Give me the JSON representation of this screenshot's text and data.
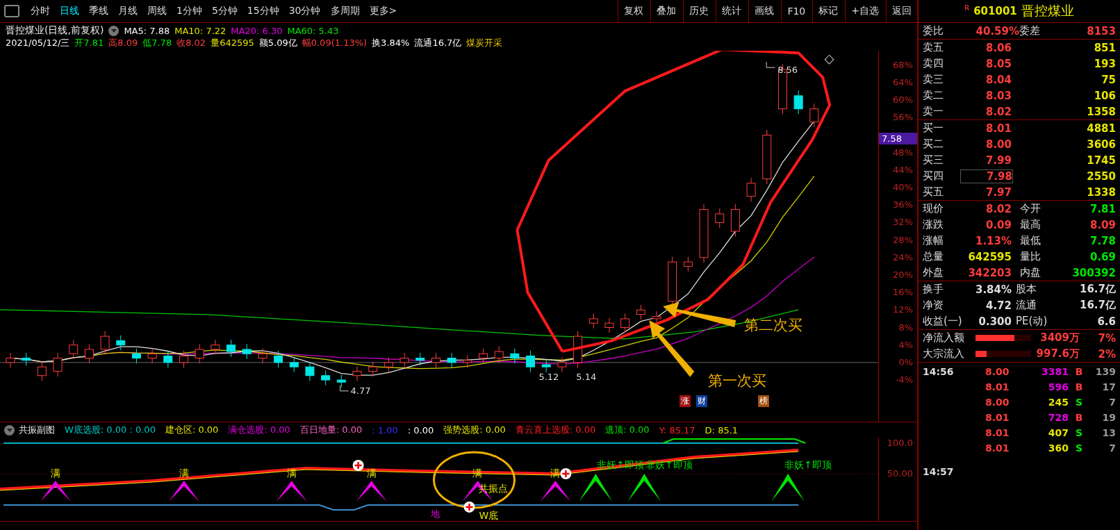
{
  "toolbar": {
    "tabs": [
      {
        "label": "分时",
        "selected": false
      },
      {
        "label": "日线",
        "selected": true
      },
      {
        "label": "季线",
        "selected": false
      },
      {
        "label": "月线",
        "selected": false
      },
      {
        "label": "周线",
        "selected": false
      },
      {
        "label": "1分钟",
        "selected": false
      },
      {
        "label": "5分钟",
        "selected": false
      },
      {
        "label": "15分钟",
        "selected": false
      },
      {
        "label": "30分钟",
        "selected": false
      },
      {
        "label": "多周期",
        "selected": false
      },
      {
        "label": "更多>",
        "selected": false
      }
    ],
    "buttons": [
      "复权",
      "叠加",
      "历史",
      "统计",
      "画线",
      "F10",
      "标记",
      "+自选",
      "返回"
    ]
  },
  "chart_header": {
    "title": "晋控煤业(日线,前复权)",
    "averages": [
      {
        "label": "MA5: 7.88",
        "color": "#ffffff"
      },
      {
        "label": "MA10: 7.22",
        "color": "#e6e600"
      },
      {
        "label": "MA20: 6.30",
        "color": "#e600e6"
      },
      {
        "label": "MA60: 5.43",
        "color": "#00e600"
      }
    ],
    "quote": [
      {
        "text": "2021/05/12/三",
        "color": "#ffffff"
      },
      {
        "text": "开7.81",
        "color": "#00e600"
      },
      {
        "text": "高8.09",
        "color": "#ff3c3c"
      },
      {
        "text": "低7.78",
        "color": "#00e600"
      },
      {
        "text": "收8.02",
        "color": "#ff3c3c"
      },
      {
        "text": "量642595",
        "color": "#e6e600"
      },
      {
        "text": "额5.09亿",
        "color": "#ffffff"
      },
      {
        "text": "幅0.09(1.13%)",
        "color": "#ff3c3c"
      },
      {
        "text": "换3.84%",
        "color": "#ffffff"
      },
      {
        "text": "流通16.7亿",
        "color": "#ffffff"
      },
      {
        "text": "煤炭开采",
        "color": "#e6c800"
      }
    ]
  },
  "price_axis": [
    "68%",
    "64%",
    "60%",
    "56%",
    "48%",
    "44%",
    "40%",
    "36%",
    "32%",
    "28%",
    "24%",
    "20%",
    "16%",
    "12%",
    "8%",
    "4%",
    "0%",
    "-4%"
  ],
  "price_tag": "7.58",
  "chart_labels": {
    "high": "8.56",
    "low": "4.77",
    "left_mark": "5.12",
    "right_mark": "5.14"
  },
  "event_marks": [
    "涨",
    "财",
    "榜"
  ],
  "callouts": [
    "第二次买",
    "第一次买"
  ],
  "indicator": {
    "title": "共振副图",
    "values": [
      {
        "text": "W底选股: 0.00 : 0.00",
        "color": "#00c8c8"
      },
      {
        "text": "建仓区: 0.00",
        "color": "#e6e600"
      },
      {
        "text": "满仓选股: 0.00",
        "color": "#e600e6"
      },
      {
        "text": "百日地量: 0.00",
        "color": "#ff64c8"
      },
      {
        "text": ": 1.00",
        "color": "#3232ff"
      },
      {
        "text": ": 0.00",
        "color": "#ffffff"
      },
      {
        "text": "强势选股: 0.00",
        "color": "#e6e600"
      },
      {
        "text": "青云直上选股: 0.00",
        "color": "#ff2020"
      },
      {
        "text": "逃顶: 0.00",
        "color": "#00e600"
      },
      {
        "text": "Y: 85.17",
        "color": "#ff2020"
      },
      {
        "text": "D: 85.1",
        "color": "#e6e600"
      }
    ],
    "axis": [
      "100.0",
      "50.00"
    ],
    "full_marks": [
      "满",
      "满",
      "满",
      "满",
      "满",
      "满"
    ],
    "top_marks": [
      "非妖↑即顶",
      "非妖↑即顶",
      "非妖↑即顶"
    ],
    "resonance": "共振点",
    "w_bottom": "W底",
    "ground": "地"
  },
  "quote_panel": {
    "flag": "R",
    "code": "601001",
    "name": "晋控煤业",
    "ratio": {
      "label": "委比",
      "value": "40.59%",
      "diff_label": "委差",
      "diff": "8153"
    },
    "asks": [
      {
        "label": "卖五",
        "price": "8.06",
        "volume": "851"
      },
      {
        "label": "卖四",
        "price": "8.05",
        "volume": "193"
      },
      {
        "label": "卖三",
        "price": "8.04",
        "volume": "75"
      },
      {
        "label": "卖二",
        "price": "8.03",
        "volume": "106"
      },
      {
        "label": "卖一",
        "price": "8.02",
        "volume": "1358"
      }
    ],
    "bids": [
      {
        "label": "买一",
        "price": "8.01",
        "volume": "4881",
        "selected": false
      },
      {
        "label": "买二",
        "price": "8.00",
        "volume": "3606",
        "selected": false
      },
      {
        "label": "买三",
        "price": "7.99",
        "volume": "1745",
        "selected": false
      },
      {
        "label": "买四",
        "price": "7.98",
        "volume": "2550",
        "selected": true
      },
      {
        "label": "买五",
        "price": "7.97",
        "volume": "1338",
        "selected": false
      }
    ],
    "stats": [
      {
        "label": "现价",
        "value": "8.02",
        "color": "#ff3c3c"
      },
      {
        "label": "今开",
        "value": "7.81",
        "color": "#00e600"
      },
      {
        "label": "涨跌",
        "value": "0.09",
        "color": "#ff3c3c"
      },
      {
        "label": "最高",
        "value": "8.09",
        "color": "#ff3c3c"
      },
      {
        "label": "涨幅",
        "value": "1.13%",
        "color": "#ff3c3c"
      },
      {
        "label": "最低",
        "value": "7.78",
        "color": "#00e600"
      },
      {
        "label": "总量",
        "value": "642595",
        "color": "#e6e600"
      },
      {
        "label": "量比",
        "value": "0.69",
        "color": "#00e600"
      },
      {
        "label": "外盘",
        "value": "342203",
        "color": "#ff3c3c"
      },
      {
        "label": "内盘",
        "value": "300392",
        "color": "#00e600"
      }
    ],
    "info": [
      {
        "l1": "换手",
        "v1": "3.84%",
        "l2": "股本",
        "v2": "16.7亿"
      },
      {
        "l1": "净资",
        "v1": "4.72",
        "l2": "流通",
        "v2": "16.7亿"
      },
      {
        "l1": "收益(一)",
        "v1": "0.300",
        "l2": "PE(动)",
        "v2": "6.6"
      }
    ],
    "flows": [
      {
        "label": "净流入额",
        "level": 0.7,
        "amount": "3409万",
        "percent": "7%"
      },
      {
        "label": "大宗流入",
        "level": 0.2,
        "amount": "997.6万",
        "percent": "2%"
      }
    ],
    "ticks": [
      {
        "time": "14:56",
        "price": "8.00",
        "volume": "3381",
        "side": "B",
        "count": "139"
      },
      {
        "price": "8.01",
        "volume": "596",
        "side": "B",
        "count": "17"
      },
      {
        "price": "8.00",
        "volume": "245",
        "side": "S",
        "count": "7"
      },
      {
        "price": "8.01",
        "volume": "728",
        "side": "B",
        "count": "19"
      },
      {
        "price": "8.01",
        "volume": "407",
        "side": "S",
        "count": "13"
      },
      {
        "price": "8.01",
        "volume": "360",
        "side": "S",
        "count": "7"
      }
    ],
    "next_time": "14:57"
  }
}
